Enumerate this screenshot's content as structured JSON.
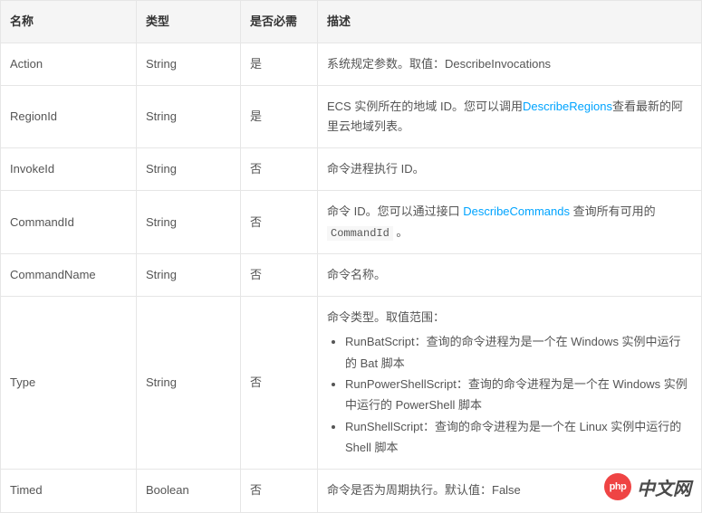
{
  "table": {
    "headers": {
      "name": "名称",
      "type": "类型",
      "required": "是否必需",
      "desc": "描述"
    },
    "rows": [
      {
        "name": "Action",
        "type": "String",
        "required": "是",
        "desc_plain": "系统规定参数。取值：DescribeInvocations"
      },
      {
        "name": "RegionId",
        "type": "String",
        "required": "是",
        "desc_pre": "ECS 实例所在的地域 ID。您可以调用",
        "desc_link": "DescribeRegions",
        "desc_post": "查看最新的阿里云地域列表。"
      },
      {
        "name": "InvokeId",
        "type": "String",
        "required": "否",
        "desc_plain": "命令进程执行 ID。"
      },
      {
        "name": "CommandId",
        "type": "String",
        "required": "否",
        "desc_pre": "命令 ID。您可以通过接口 ",
        "desc_link": "DescribeCommands",
        "desc_post": " 查询所有可用的 ",
        "desc_code": "CommandId",
        "desc_tail": " 。"
      },
      {
        "name": "CommandName",
        "type": "String",
        "required": "否",
        "desc_plain": "命令名称。"
      },
      {
        "name": "Type",
        "type": "String",
        "required": "否",
        "desc_intro": "命令类型。取值范围：",
        "items": [
          "RunBatScript：查询的命令进程为是一个在 Windows 实例中运行的 Bat 脚本",
          "RunPowerShellScript：查询的命令进程为是一个在 Windows 实例中运行的 PowerShell 脚本",
          "RunShellScript：查询的命令进程为是一个在 Linux 实例中运行的 Shell 脚本"
        ]
      },
      {
        "name": "Timed",
        "type": "Boolean",
        "required": "否",
        "desc_plain": "命令是否为周期执行。默认值：False"
      }
    ]
  },
  "watermark": {
    "logo": "php",
    "text": "中文网"
  }
}
